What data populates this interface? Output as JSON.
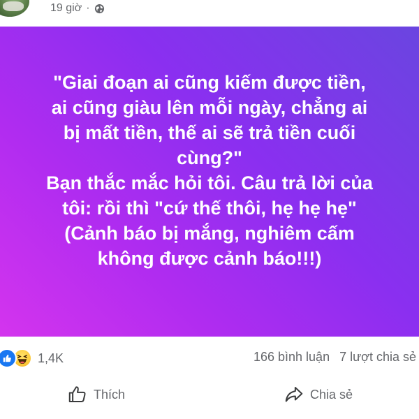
{
  "post": {
    "time": "19 giờ",
    "separator": "·",
    "privacy_icon": "globe-icon",
    "text_lines": [
      "\"Giai đoạn ai cũng kiếm được tiền,",
      "ai cũng giàu lên mỗi ngày, chẳng ai",
      "bị mất tiền, thế ai sẽ trả tiền cuối",
      "cùng?\"",
      "Bạn thắc mắc hỏi tôi. Câu trả lời của",
      "tôi: rồi thì \"cứ thế thôi, hẹ hẹ hẹ\"",
      "(Cảnh báo bị mắng, nghiêm cấm",
      "không được cảnh báo!!!)"
    ],
    "background_colors": [
      "#6a45e0",
      "#8a2ff0",
      "#b02cf0",
      "#d434ee"
    ]
  },
  "stats": {
    "reaction_icons": [
      "like-icon",
      "haha-icon"
    ],
    "reaction_count": "1,4K",
    "comments": "166 bình luận",
    "shares": "7 lượt chia sẻ"
  },
  "actions": {
    "like_label": "Thích",
    "share_label": "Chia sẻ"
  },
  "colors": {
    "like_blue": "#1877f2",
    "muted_text": "#65676b"
  }
}
